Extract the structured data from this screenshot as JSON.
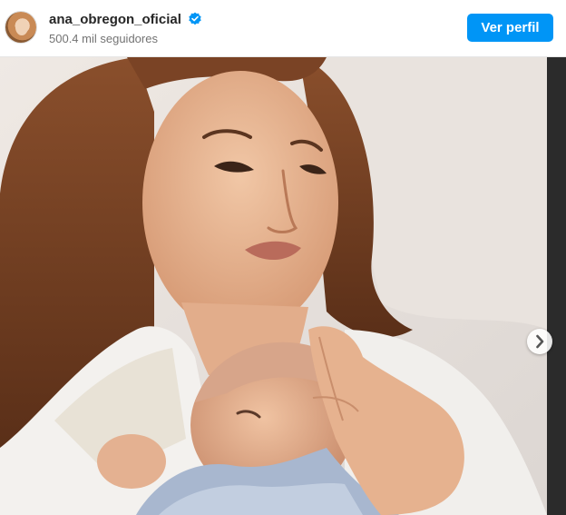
{
  "header": {
    "username": "ana_obregon_oficial",
    "followers": "500.4 mil seguidores",
    "view_profile_label": "Ver perfil",
    "verified_icon": "verified-badge-icon"
  },
  "post": {
    "next_icon": "chevron-right-icon"
  },
  "colors": {
    "accent": "#0095f6",
    "verified": "#0095f6",
    "username": "#262626",
    "secondary_text": "#737373"
  }
}
